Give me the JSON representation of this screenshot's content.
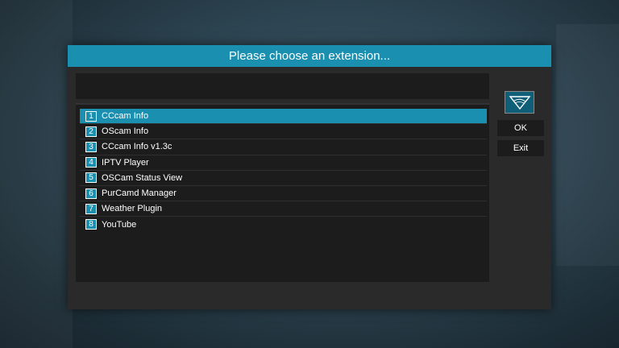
{
  "dialog": {
    "title": "Please choose an extension..."
  },
  "header_text": "",
  "items": [
    {
      "num": "1",
      "label": "CCcam Info",
      "selected": true
    },
    {
      "num": "2",
      "label": "OScam Info",
      "selected": false
    },
    {
      "num": "3",
      "label": "CCcam Info v1.3c",
      "selected": false
    },
    {
      "num": "4",
      "label": "IPTV Player",
      "selected": false
    },
    {
      "num": "5",
      "label": "OSCam Status View",
      "selected": false
    },
    {
      "num": "6",
      "label": "PurCamd Manager",
      "selected": false
    },
    {
      "num": "7",
      "label": "Weather Plugin",
      "selected": false
    },
    {
      "num": "8",
      "label": "YouTube",
      "selected": false
    }
  ],
  "buttons": {
    "ok_label": "OK",
    "exit_label": "Exit"
  },
  "colors": {
    "accent": "#1a8fb0",
    "panel": "#2a2a2a",
    "list_bg": "#1c1c1c"
  },
  "icons": {
    "logo": "purple-v-logo-icon"
  }
}
